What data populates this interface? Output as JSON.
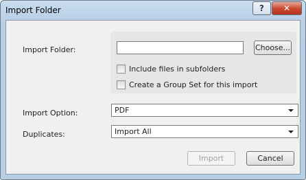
{
  "window": {
    "title": "Import Folder",
    "help_glyph": "?",
    "close_glyph": "✕"
  },
  "form": {
    "folder_label": "Import Folder:",
    "folder_value": "",
    "choose_label": "Choose...",
    "include_subfolders_label": "Include files in subfolders",
    "include_subfolders_checked": false,
    "group_set_label": "Create a Group Set for this import",
    "group_set_checked": false,
    "import_option_label": "Import Option:",
    "import_option_value": "PDF",
    "duplicates_label": "Duplicates:",
    "duplicates_value": "Import All"
  },
  "buttons": {
    "import_label": "Import",
    "cancel_label": "Cancel"
  }
}
